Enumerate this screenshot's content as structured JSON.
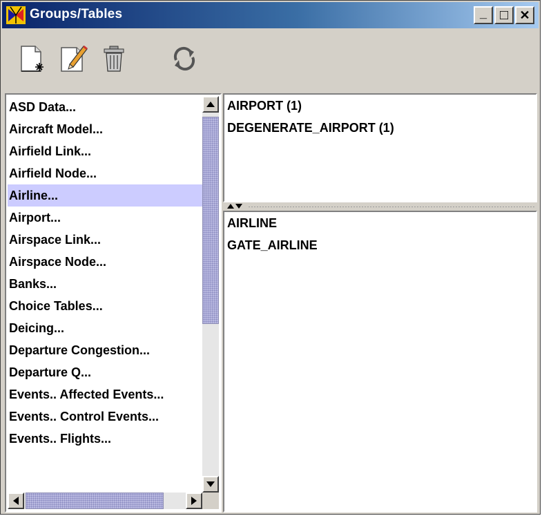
{
  "window": {
    "title": "Groups/Tables",
    "controls": {
      "minimize": "_",
      "maximize": "□",
      "close": "✕"
    }
  },
  "toolbar": {
    "buttons": [
      {
        "name": "new-document",
        "icon": "new-document-icon"
      },
      {
        "name": "edit",
        "icon": "edit-pencil-icon"
      },
      {
        "name": "delete",
        "icon": "trash-icon"
      },
      {
        "name": "refresh",
        "icon": "refresh-icon"
      }
    ]
  },
  "groups": {
    "items": [
      "ASD Data...",
      "Aircraft Model...",
      "Airfield Link...",
      "Airfield Node...",
      "Airline...",
      "Airport...",
      "Airspace Link...",
      "Airspace Node...",
      "Banks...",
      "Choice Tables...",
      "Deicing...",
      "Departure Congestion...",
      "Departure Q...",
      "Events.. Affected Events...",
      "Events.. Control Events...",
      "Events.. Flights..."
    ],
    "selected_index": 4
  },
  "upper_pane": {
    "items": [
      "AIRPORT (1)",
      "DEGENERATE_AIRPORT (1)"
    ]
  },
  "lower_pane": {
    "items": [
      "AIRLINE",
      "GATE_AIRLINE"
    ]
  },
  "colors": {
    "selection": "#ccccff",
    "title_gradient_start": "#0a246a",
    "title_gradient_end": "#a6caf0",
    "scroll_thumb": "#b8b8e0"
  }
}
